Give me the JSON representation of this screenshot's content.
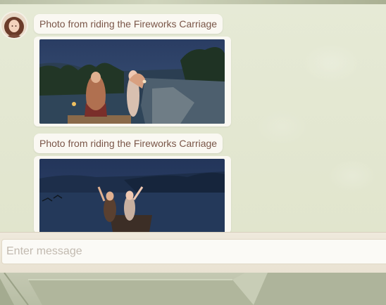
{
  "chat": {
    "messages": [
      {
        "caption": "Photo from riding the Fireworks Carriage",
        "photo": "screenshot-photo-night-cliff"
      },
      {
        "caption": "Photo from riding the Fireworks Carriage",
        "photo": "screenshot-photo-night-lake"
      }
    ]
  },
  "input": {
    "placeholder": "Enter message"
  },
  "colors": {
    "background": "#e4e8d2",
    "bubble": "#faf8f2",
    "caption_text": "#7a5648",
    "placeholder_text": "#c2bab0"
  }
}
